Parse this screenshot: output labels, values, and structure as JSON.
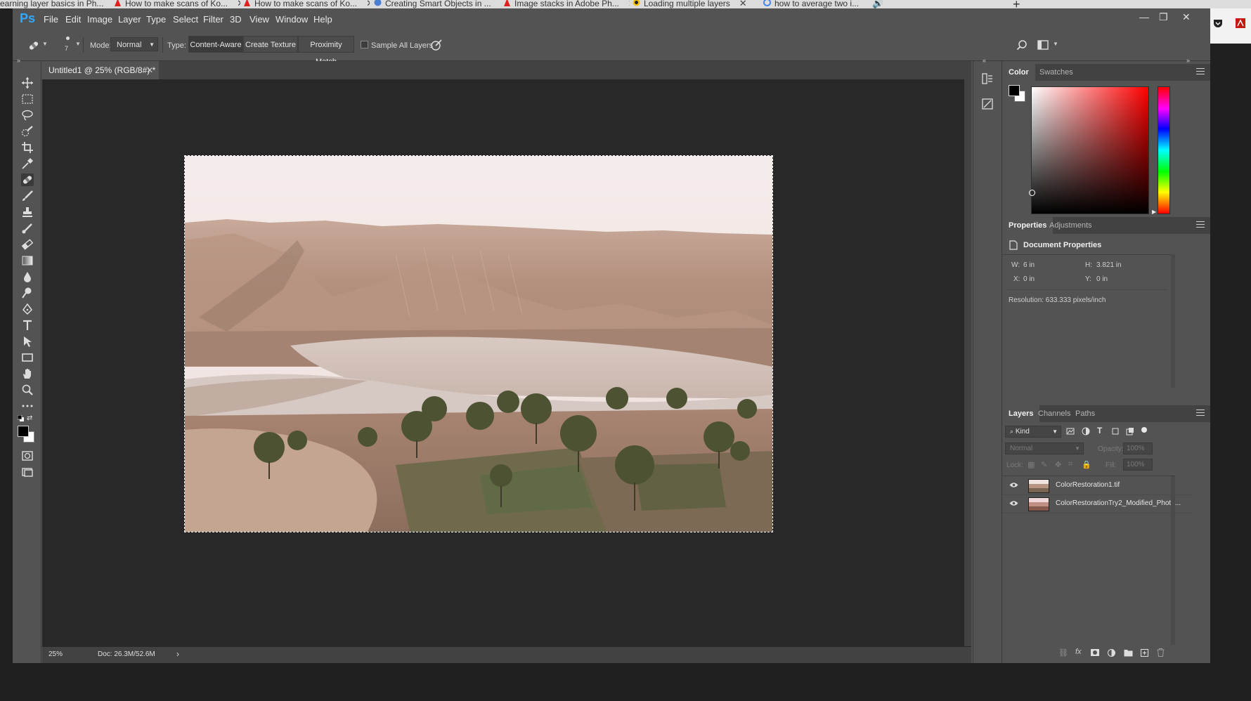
{
  "browser": {
    "tabs": [
      {
        "title": "earning layer basics in Ph...",
        "icon": "globe-icon"
      },
      {
        "title": "How to make scans of Ko...",
        "icon": "adobe-icon"
      },
      {
        "title": "How to make scans of Ko...",
        "icon": "adobe-icon"
      },
      {
        "title": "Creating Smart Objects in ...",
        "icon": "globe-icon"
      },
      {
        "title": "Image stacks in Adobe Ph...",
        "icon": "adobe-icon"
      },
      {
        "title": "Loading multiple layers",
        "icon": "globe-icon"
      },
      {
        "title": "how to average two i...",
        "icon": "google-icon"
      }
    ],
    "new_tab": "+"
  },
  "app": {
    "logo": "Ps",
    "menu": [
      "File",
      "Edit",
      "Image",
      "Layer",
      "Type",
      "Select",
      "Filter",
      "3D",
      "View",
      "Window",
      "Help"
    ],
    "window_controls": [
      "—",
      "❐",
      "✕"
    ]
  },
  "options": {
    "brush_size": "7",
    "mode_label": "Mode:",
    "mode_value": "Normal",
    "type_label": "Type:",
    "type_buttons": [
      "Content-Aware",
      "Create Texture",
      "Proximity Match"
    ],
    "type_selected": "Content-Aware",
    "sample_all_layers_label": "Sample All Layers",
    "sample_all_layers_checked": false
  },
  "tools": [
    "move-tool-icon",
    "marquee-tool-icon",
    "lasso-tool-icon",
    "quick-selection-tool-icon",
    "crop-tool-icon",
    "eyedropper-tool-icon",
    "spot-healing-brush-icon",
    "brush-tool-icon",
    "clone-stamp-icon",
    "history-brush-icon",
    "eraser-tool-icon",
    "gradient-tool-icon",
    "blur-tool-icon",
    "dodge-tool-icon",
    "pen-tool-icon",
    "type-tool-icon",
    "path-selection-icon",
    "rectangle-tool-icon",
    "hand-tool-icon",
    "zoom-tool-icon",
    "more-tools-icon"
  ],
  "active_tool": "spot-healing-brush-icon",
  "document": {
    "tab_title": "Untitled1 @ 25% (RGB/8#) *",
    "zoom": "25%",
    "doc_size": "Doc: 26.3M/52.6M"
  },
  "color_panel": {
    "tabs": [
      "Color",
      "Swatches"
    ],
    "active_tab": "Color",
    "foreground": "#000000",
    "background": "#ffffff",
    "hue": "#ff0000"
  },
  "properties_panel": {
    "tabs": [
      "Properties",
      "Adjustments"
    ],
    "active_tab": "Properties",
    "heading": "Document Properties",
    "w_label": "W:",
    "w_value": "6 in",
    "h_label": "H:",
    "h_value": "3.821 in",
    "x_label": "X:",
    "x_value": "0 in",
    "y_label": "Y:",
    "y_value": "0 in",
    "resolution": "Resolution: 633.333 pixels/inch"
  },
  "layers_panel": {
    "tabs": [
      "Layers",
      "Channels",
      "Paths"
    ],
    "active_tab": "Layers",
    "filter_kind": "Kind",
    "blend_mode": "Normal",
    "opacity_label": "Opacity:",
    "opacity_value": "100%",
    "lock_label": "Lock:",
    "fill_label": "Fill:",
    "fill_value": "100%",
    "layers": [
      {
        "name": "ColorRestoration1.tif",
        "visible": true
      },
      {
        "name": "ColorRestorationTry2_Modified_Photo...",
        "visible": true
      }
    ]
  }
}
